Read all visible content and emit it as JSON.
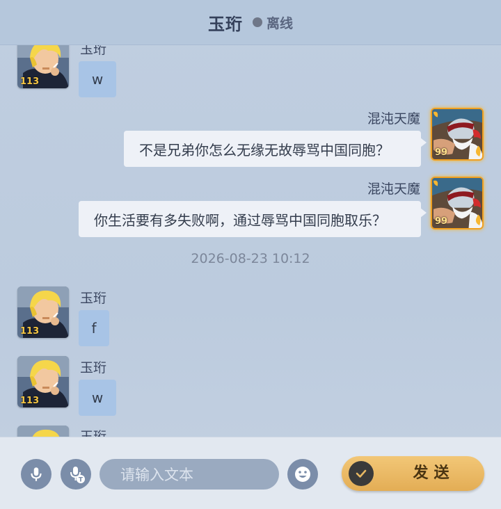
{
  "header": {
    "title": "玉珩",
    "status": "离线"
  },
  "messages": [
    {
      "sender": "玉珩",
      "text": "w",
      "level": "113"
    },
    {
      "sender": "混沌天魔",
      "text": "不是兄弟你怎么无缘无故辱骂中国同胞？",
      "level": "99"
    },
    {
      "sender": "混沌天魔",
      "text": "你生活要有多失败啊，通过辱骂中国同胞取乐？",
      "level": "99"
    },
    {
      "sender": "玉珩",
      "text": "f",
      "level": "113"
    },
    {
      "sender": "玉珩",
      "text": "w",
      "level": "113"
    },
    {
      "sender": "玉珩",
      "text": "",
      "level": ""
    }
  ],
  "timestamp": "2026-08-23 10:12",
  "input": {
    "placeholder": "请输入文本"
  },
  "send_label": "发送",
  "icons": {
    "voice": "microphone-icon",
    "voice_to_text": "microphone-text-icon",
    "emoji": "smiley-icon",
    "send": "checkmark-icon"
  },
  "colors": {
    "left_bubble": "#a8c4e6",
    "right_bubble": "#eef1f7",
    "send_button": "#e8b862",
    "header": "#b5c7dc"
  }
}
